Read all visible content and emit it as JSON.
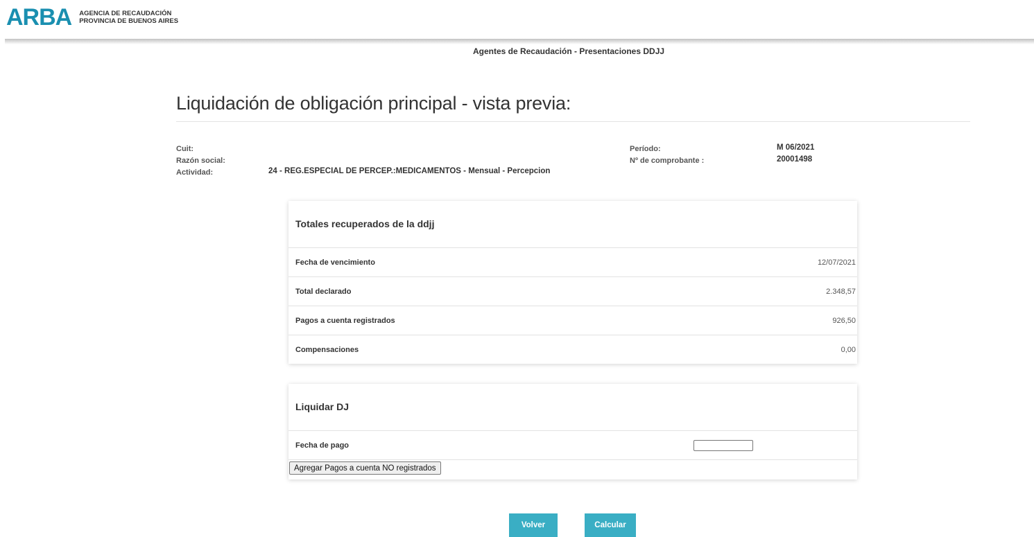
{
  "brand": {
    "logo": "ARBA",
    "line1": "AGENCIA DE RECAUDACIÓN",
    "line2": "PROVINCIA DE BUENOS AIRES"
  },
  "header": {
    "section": "Agentes de Recaudación - Presentaciones DDJJ"
  },
  "page": {
    "title": "Liquidación de obligación principal - vista previa:"
  },
  "info": {
    "cuit_label": "Cuit:",
    "cuit_value": "",
    "razon_label": "Razón social:",
    "razon_value": "",
    "actividad_label": "Actividad:",
    "actividad_value": "24 - REG.ESPECIAL DE PERCEP.:MEDICAMENTOS - Mensual - Percepcion",
    "periodo_label": "Período:",
    "periodo_value": "M 06/2021",
    "comprobante_label": "Nº de comprobante :",
    "comprobante_value": "20001498"
  },
  "totales": {
    "title": "Totales recuperados de la ddjj",
    "rows": [
      {
        "label": "Fecha de vencimiento",
        "value": "12/07/2021"
      },
      {
        "label": "Total declarado",
        "value": "2.348,57"
      },
      {
        "label": "Pagos a cuenta registrados",
        "value": "926,50"
      },
      {
        "label": "Compensaciones",
        "value": "0,00"
      }
    ]
  },
  "liquidar": {
    "title": "Liquidar DJ",
    "fecha_label": "Fecha de pago",
    "fecha_value": "",
    "agregar_button": "Agregar Pagos a cuenta NO registrados"
  },
  "actions": {
    "volver": "Volver",
    "calcular": "Calcular"
  },
  "colors": {
    "brand": "#1a8fb0",
    "button": "#3aaec4"
  }
}
